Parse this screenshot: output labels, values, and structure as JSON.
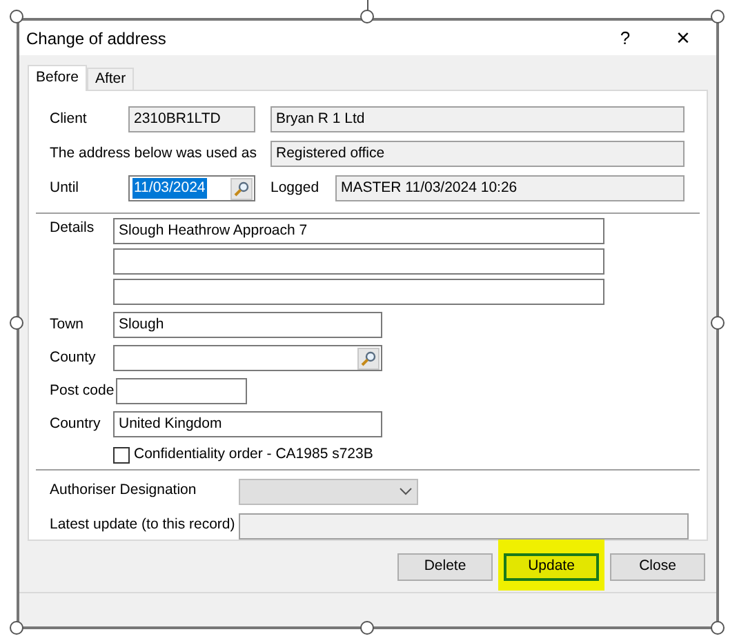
{
  "window": {
    "title": "Change of address",
    "help": "?",
    "close": "×"
  },
  "tabs": [
    {
      "label": "Before",
      "selected": true
    },
    {
      "label": "After",
      "selected": false
    }
  ],
  "client": {
    "label": "Client",
    "code": "2310BR1LTD",
    "name": "Bryan R 1 Ltd"
  },
  "address_used_as": {
    "label": "The address below was used as",
    "value": "Registered office"
  },
  "until": {
    "label": "Until",
    "value": "11/03/2024",
    "text_selected": true
  },
  "logged": {
    "label": "Logged",
    "value": "MASTER 11/03/2024 10:26"
  },
  "details": {
    "label": "Details",
    "lines": [
      {
        "kind": "filled",
        "value": "Slough Heathrow Approach 7"
      },
      {
        "kind": "blank"
      },
      {
        "kind": "blank"
      }
    ]
  },
  "address_fields": [
    {
      "label": "Town",
      "value": "Slough",
      "kind": "text"
    },
    {
      "label": "County",
      "kind": "lookup"
    },
    {
      "label": "Post code",
      "kind": "short"
    },
    {
      "label": "Country",
      "value": "United Kingdom",
      "kind": "text"
    }
  ],
  "confidentiality": {
    "label": "Confidentiality order - CA1985 s723B",
    "checked": false
  },
  "authoriser": {
    "label": "Authoriser Designation",
    "disabled": true
  },
  "latest_update": {
    "label": "Latest update (to this record)"
  },
  "buttons": [
    {
      "label": "Delete",
      "highlighted": false
    },
    {
      "label": "Update",
      "highlighted": true
    },
    {
      "label": "Close",
      "highlighted": false
    }
  ]
}
